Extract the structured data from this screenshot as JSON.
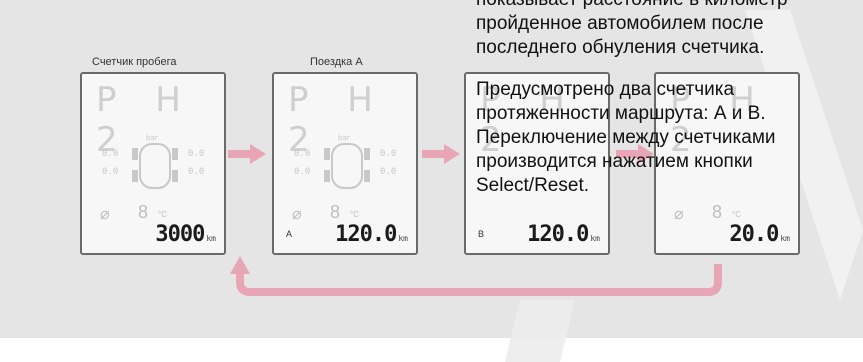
{
  "captions": {
    "odometer": "Счетчик пробега",
    "trip_a": "Поездка А"
  },
  "displays": [
    {
      "gear": "P H 2",
      "temp": "8",
      "temp_unit": "°C",
      "odometer": "3000",
      "unit": "km",
      "trip_mark": ""
    },
    {
      "gear": "P H 2",
      "temp": "8",
      "temp_unit": "°C",
      "odometer": "120.0",
      "unit": "km",
      "trip_mark": "A"
    },
    {
      "gear": "P H 2",
      "temp": "",
      "temp_unit": "",
      "odometer": "120.0",
      "unit": "km",
      "trip_mark": "B"
    },
    {
      "gear": "P H 2",
      "temp": "8",
      "temp_unit": "°C",
      "odometer": "20.0",
      "unit": "km",
      "trip_mark": ""
    }
  ],
  "tpms_values": [
    "0.0",
    "0.0",
    "0.0",
    "0.0",
    "0.0",
    "0.0",
    "0.0",
    "0.0"
  ],
  "tpms_label": "bar",
  "text": {
    "p1_line1": "показывает расстояние в километр",
    "p1_line2": "пройденное автомобилем после",
    "p1_line3": "последнего обнуления счетчика.",
    "p2_line1": "Предусмотрено два счетчика",
    "p2_line2": "протяженности маршрута: А и В.",
    "p2_line3": "Переключение между счетчиками",
    "p2_line4": "производится нажатием кнопки",
    "p2_line5": "Select/Reset."
  },
  "colors": {
    "arrow": "#e8a5b5",
    "panel": "#e5e5e5"
  }
}
